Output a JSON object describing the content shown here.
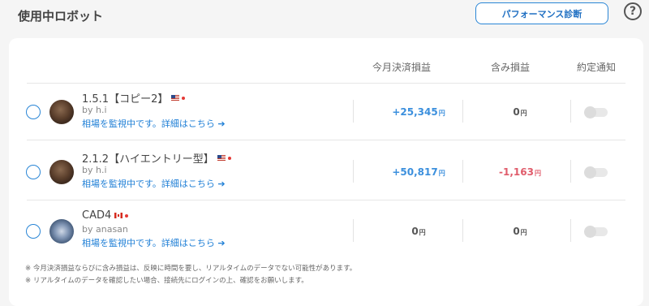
{
  "header": {
    "title": "使用中ロボット",
    "performance_button": "パフォーマンス診断",
    "help_icon": "question-circle-icon",
    "help_glyph": "?"
  },
  "table": {
    "columns": [
      "今月決済損益",
      "含み損益",
      "約定通知"
    ],
    "rows": [
      {
        "name": "1.5.1【コピー2】",
        "flag": "us",
        "author": "by h.i",
        "link": "相場を監視中です。詳細はこちら",
        "arrow": "➔",
        "monthly_pl": "+25,345",
        "unrealized_pl": "0",
        "yen": "円",
        "notify": false
      },
      {
        "name": "2.1.2【ハイエントリー型】",
        "flag": "us",
        "author": "by h.i",
        "link": "相場を監視中です。詳細はこちら",
        "arrow": "➔",
        "monthly_pl": "+50,817",
        "unrealized_pl": "-1,163",
        "yen": "円",
        "notify": false
      },
      {
        "name": "CAD4",
        "flag": "ca",
        "author": "by anasan",
        "link": "相場を監視中です。詳細はこちら",
        "arrow": "➔",
        "monthly_pl": "0",
        "unrealized_pl": "0",
        "yen": "円",
        "notify": false
      }
    ]
  },
  "notes": [
    "※ 今月決済損益ならびに含み損益は、反映に時間を要し、リアルタイムのデータでない可能性があります。",
    "※ リアルタイムのデータを確認したい場合、接続先にログインの上、確認をお願いします。"
  ],
  "colors": {
    "accent": "#2a86d6",
    "positive": "#3b8fdd",
    "negative": "#e05c6b"
  }
}
